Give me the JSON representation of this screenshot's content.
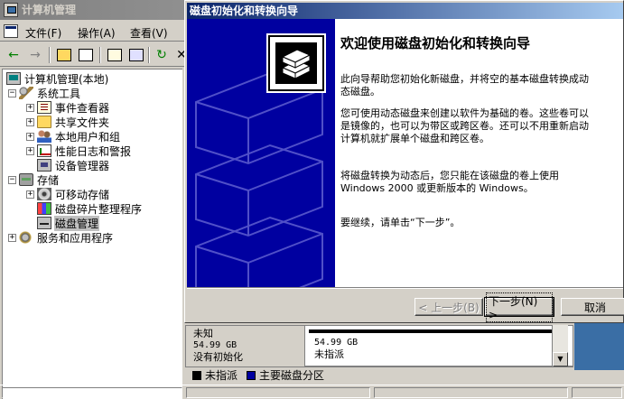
{
  "window": {
    "title": "计算机管理"
  },
  "menu": [
    "文件(F)",
    "操作(A)",
    "查看(V)"
  ],
  "tree": {
    "root": "计算机管理(本地)",
    "items": [
      {
        "label": "系统工具",
        "expander": "−",
        "level": 1,
        "icon": "tools-icon"
      },
      {
        "label": "事件查看器",
        "expander": "+",
        "level": 2,
        "icon": "event-viewer-icon"
      },
      {
        "label": "共享文件夹",
        "expander": "+",
        "level": 2,
        "icon": "shared-folder-icon"
      },
      {
        "label": "本地用户和组",
        "expander": "+",
        "level": 2,
        "icon": "users-icon"
      },
      {
        "label": "性能日志和警报",
        "expander": "+",
        "level": 2,
        "icon": "performance-icon"
      },
      {
        "label": "设备管理器",
        "expander": "",
        "level": 2,
        "icon": "device-manager-icon"
      },
      {
        "label": "存储",
        "expander": "−",
        "level": 1,
        "icon": "storage-icon"
      },
      {
        "label": "可移动存储",
        "expander": "+",
        "level": 2,
        "icon": "removable-storage-icon"
      },
      {
        "label": "磁盘碎片整理程序",
        "expander": "",
        "level": 2,
        "icon": "defrag-icon"
      },
      {
        "label": "磁盘管理",
        "expander": "",
        "level": 2,
        "icon": "disk-management-icon",
        "selected": true
      },
      {
        "label": "服务和应用程序",
        "expander": "+",
        "level": 1,
        "icon": "services-icon"
      }
    ]
  },
  "disk": {
    "status": "未知",
    "size": "54.99 GB",
    "init_state": "没有初始化",
    "partition_size": "54.99 GB",
    "partition_state": "未指派"
  },
  "legend": [
    {
      "label": "未指派",
      "color": "#000000"
    },
    {
      "label": "主要磁盘分区",
      "color": "#0000a0"
    }
  ],
  "wizard": {
    "title": "磁盘初始化和转换向导",
    "heading": "欢迎使用磁盘初始化和转换向导",
    "para1": "此向导帮助您初始化新磁盘，并将空的基本磁盘转换成动态磁盘。",
    "para2": "您可使用动态磁盘来创建以软件为基础的卷。这些卷可以是镜像的，也可以为带区或跨区卷。还可以不用重新启动计算机就扩展单个磁盘和跨区卷。",
    "para3": "将磁盘转换为动态后，您只能在该磁盘的卷上使用 Windows 2000 或更新版本的 Windows。",
    "para4": "要继续，请单击“下一步”。",
    "back_label": "< 上一步(B)",
    "next_label": "下一步(N) >",
    "cancel_label": "取消"
  }
}
